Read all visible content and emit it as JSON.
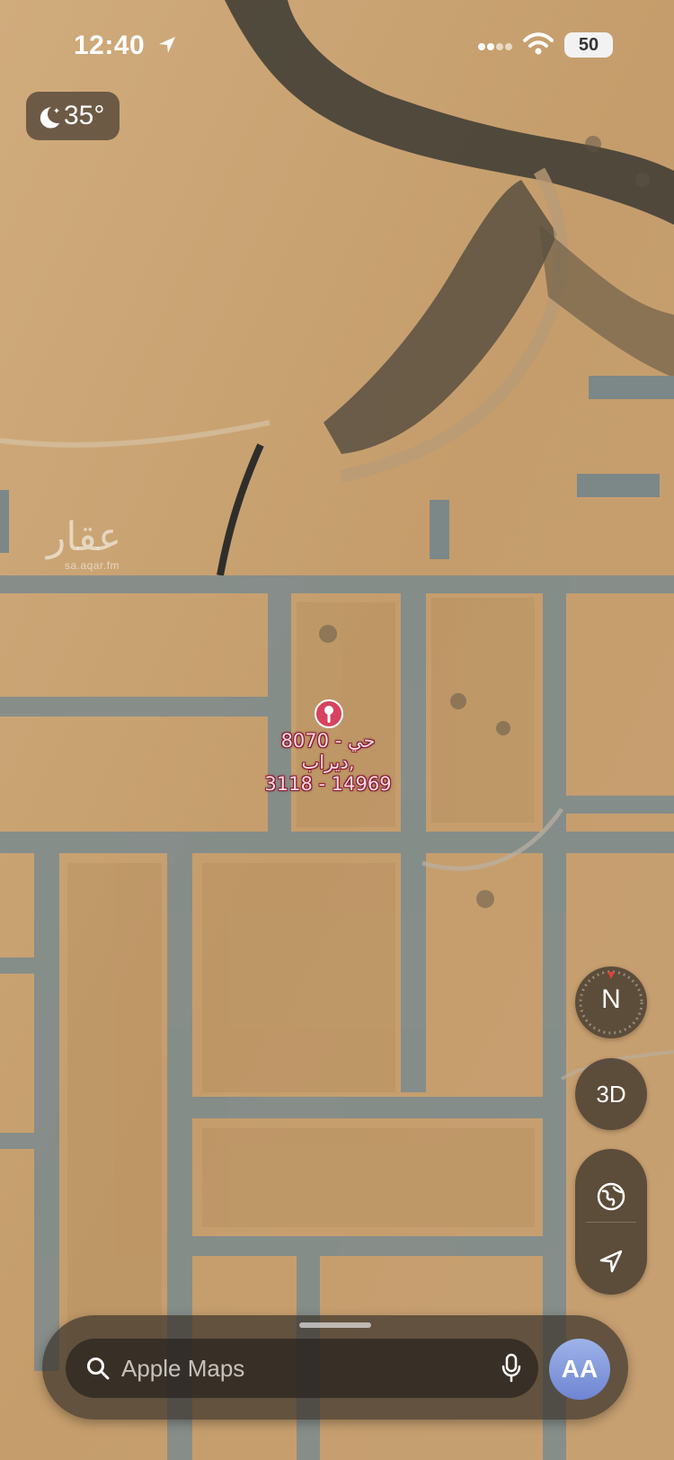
{
  "status_bar": {
    "time": "12:40",
    "battery": "50"
  },
  "weather": {
    "icon": "moon-stars-icon",
    "temperature": "35°"
  },
  "watermark": {
    "logo_text": "عقار",
    "site_text": "sa.aqar.fm"
  },
  "place_pin": {
    "color": "#d6435f",
    "label_lines": [
      "8070 - حي",
      "ديراب,",
      "3118 - 14969"
    ]
  },
  "map_controls": {
    "compass_label": "N",
    "view_3d_label": "3D",
    "globe_icon": "globe-icon",
    "location_icon": "location-arrow-icon"
  },
  "search_sheet": {
    "placeholder": "Apple Maps",
    "avatar_initials": "AA"
  },
  "colors": {
    "terrain": "#c9a578",
    "road": "#7f8c8d",
    "accent_pin": "#d6435f"
  }
}
